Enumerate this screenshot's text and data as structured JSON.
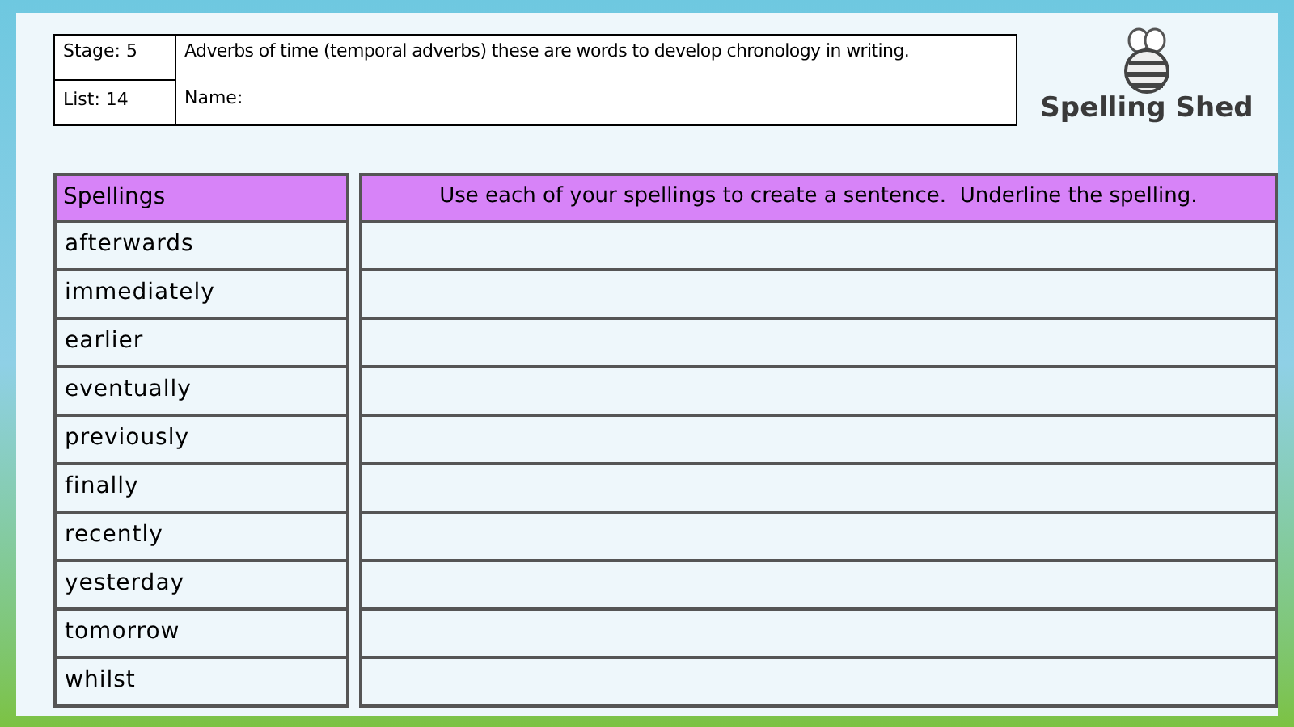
{
  "header": {
    "stage": "Stage: 5",
    "list": "List: 14",
    "description": "Adverbs of time (temporal adverbs) these are words to develop chronology in writing.",
    "name_label": "Name:"
  },
  "logo": {
    "text": "Spelling Shed"
  },
  "table": {
    "columns": [
      "Spellings",
      "Use each of your spellings to create a sentence.  Underline the spelling."
    ],
    "rows": [
      "afterwards",
      "immediately",
      "earlier",
      "eventually",
      "previously",
      "finally",
      "recently",
      "yesterday",
      "tomorrow",
      "whilst"
    ]
  }
}
